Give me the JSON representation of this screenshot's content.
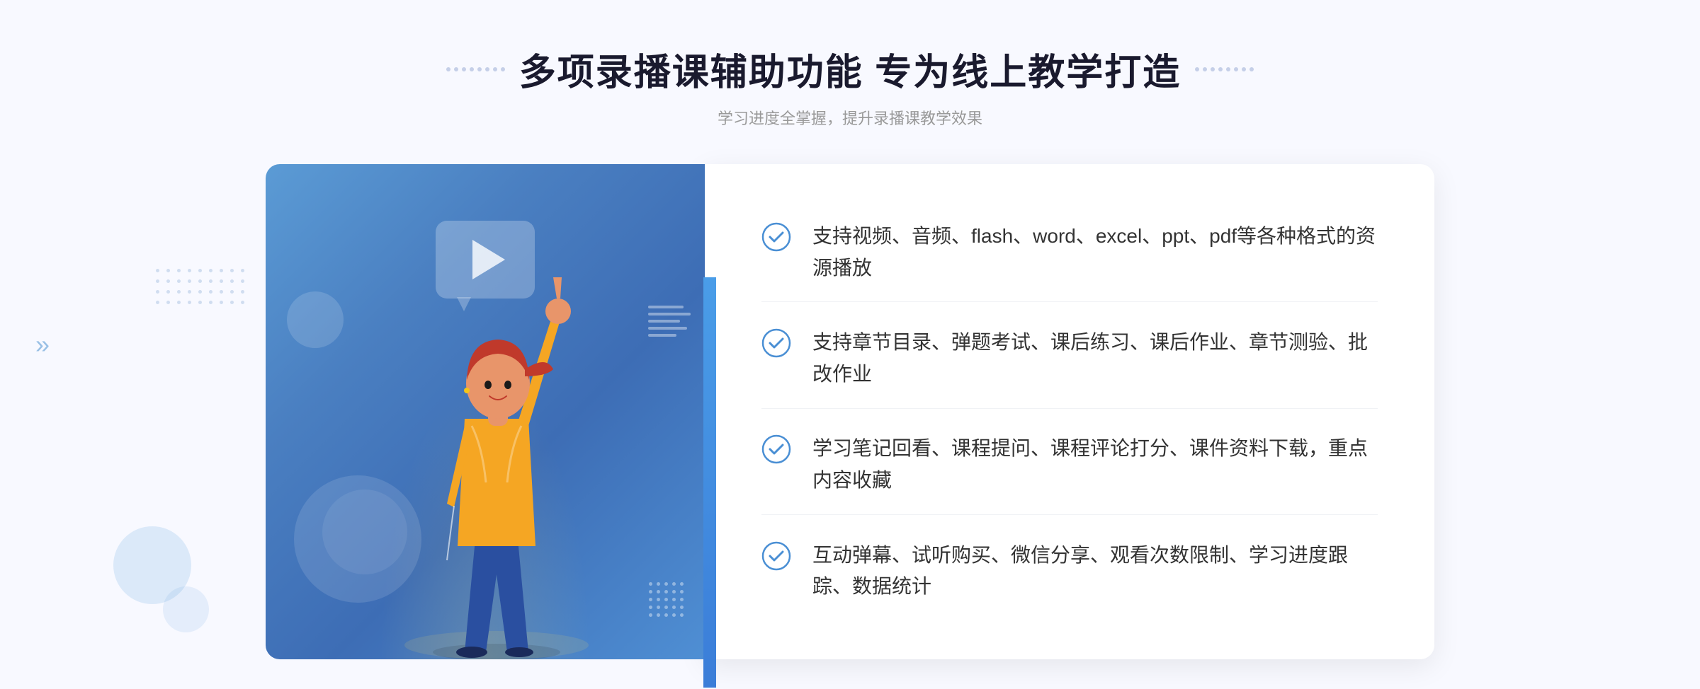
{
  "page": {
    "background": "#f5f7fb"
  },
  "header": {
    "title": "多项录播课辅助功能 专为线上教学打造",
    "subtitle": "学习进度全掌握，提升录播课教学效果"
  },
  "features": [
    {
      "id": 1,
      "text": "支持视频、音频、flash、word、excel、ppt、pdf等各种格式的资源播放"
    },
    {
      "id": 2,
      "text": "支持章节目录、弹题考试、课后练习、课后作业、章节测验、批改作业"
    },
    {
      "id": 3,
      "text": "学习笔记回看、课程提问、课程评论打分、课件资料下载，重点内容收藏"
    },
    {
      "id": 4,
      "text": "互动弹幕、试听购买、微信分享、观看次数限制、学习进度跟踪、数据统计"
    }
  ],
  "icons": {
    "check": "check-circle-icon",
    "play": "play-icon",
    "left_arrow": "left-chevron-icon"
  },
  "colors": {
    "primary_blue": "#4a8fd4",
    "dark_blue": "#3566c5",
    "text_dark": "#333333",
    "text_gray": "#999999",
    "border_light": "#f0f2f5"
  }
}
